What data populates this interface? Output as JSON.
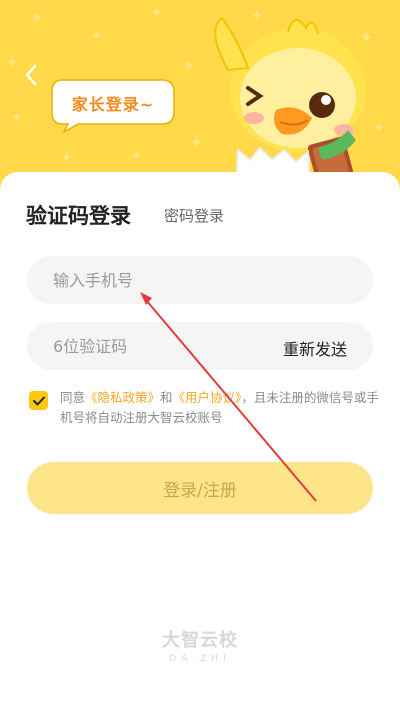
{
  "header": {
    "back_icon": "chevron-left-icon",
    "bubble_text": "家长登录~",
    "accent_color": "#FFD94A",
    "bubble_text_color": "#F28A1E"
  },
  "tabs": {
    "sms_label": "验证码登录",
    "password_label": "密码登录"
  },
  "phone": {
    "placeholder": "输入手机号",
    "value": ""
  },
  "code": {
    "placeholder": "6位验证码",
    "value": "",
    "resend_label": "重新发送"
  },
  "agreement": {
    "checked": true,
    "prefix": "同意",
    "privacy_link": "《隐私政策》",
    "and": "和",
    "user_link": "《用户协议》",
    "suffix": "，且未注册的微信号或手机号将自动注册大智云校账号",
    "link_color": "#F5A623",
    "checkbox_color": "#FFC70F"
  },
  "submit": {
    "label": "登录/注册",
    "bg_color": "#FFE58A"
  },
  "brand": {
    "name_cn": "大智云校",
    "name_en": "DA·ZHI"
  }
}
